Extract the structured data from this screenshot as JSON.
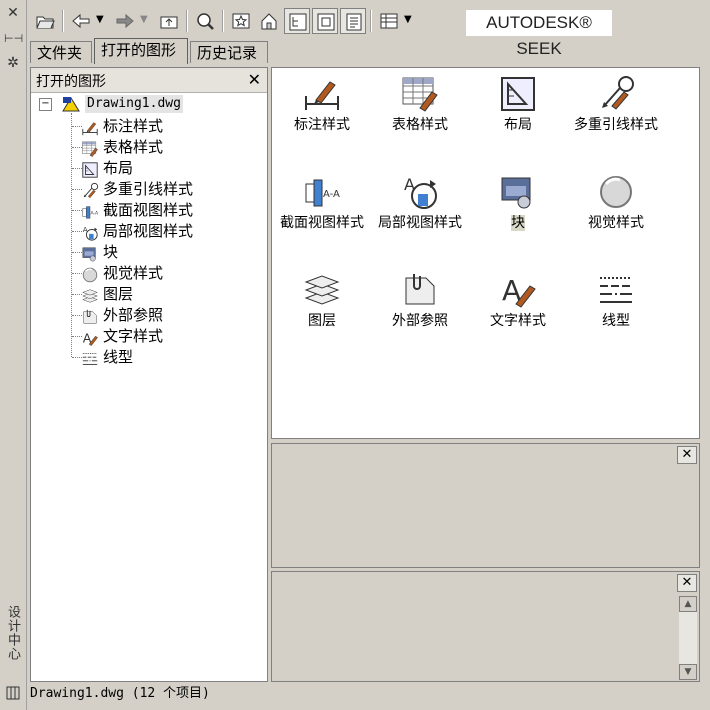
{
  "app": {
    "vertical_title": "设计中心",
    "brand_text": "AUTODESK® SEEK"
  },
  "tabs": [
    {
      "label": "文件夹"
    },
    {
      "label": "打开的图形"
    },
    {
      "label": "历史记录"
    }
  ],
  "tree": {
    "title": "打开的图形",
    "root": "Drawing1.dwg",
    "items": [
      {
        "label": "标注样式",
        "icon": "dimension-style-icon"
      },
      {
        "label": "表格样式",
        "icon": "table-style-icon"
      },
      {
        "label": "布局",
        "icon": "layout-icon"
      },
      {
        "label": "多重引线样式",
        "icon": "multileader-style-icon"
      },
      {
        "label": "截面视图样式",
        "icon": "section-view-style-icon"
      },
      {
        "label": "局部视图样式",
        "icon": "detail-view-style-icon"
      },
      {
        "label": "块",
        "icon": "block-icon"
      },
      {
        "label": "视觉样式",
        "icon": "visual-style-icon"
      },
      {
        "label": "图层",
        "icon": "layer-icon"
      },
      {
        "label": "外部参照",
        "icon": "xref-icon"
      },
      {
        "label": "文字样式",
        "icon": "text-style-icon"
      },
      {
        "label": "线型",
        "icon": "linetype-icon"
      }
    ]
  },
  "content": {
    "items": [
      {
        "label": "标注样式"
      },
      {
        "label": "表格样式"
      },
      {
        "label": "布局"
      },
      {
        "label": "多重引线样式"
      },
      {
        "label": "截面视图样式"
      },
      {
        "label": "局部视图样式"
      },
      {
        "label": "块"
      },
      {
        "label": "视觉样式"
      },
      {
        "label": "图层"
      },
      {
        "label": "外部参照"
      },
      {
        "label": "文字样式"
      },
      {
        "label": "线型"
      }
    ],
    "selected": "块"
  },
  "status": {
    "text": "Drawing1.dwg (12 个项目)"
  },
  "colors": {
    "panel_bg": "#d4d0c8",
    "content_bg": "#ffffff",
    "selection": "#d8d8c8"
  }
}
